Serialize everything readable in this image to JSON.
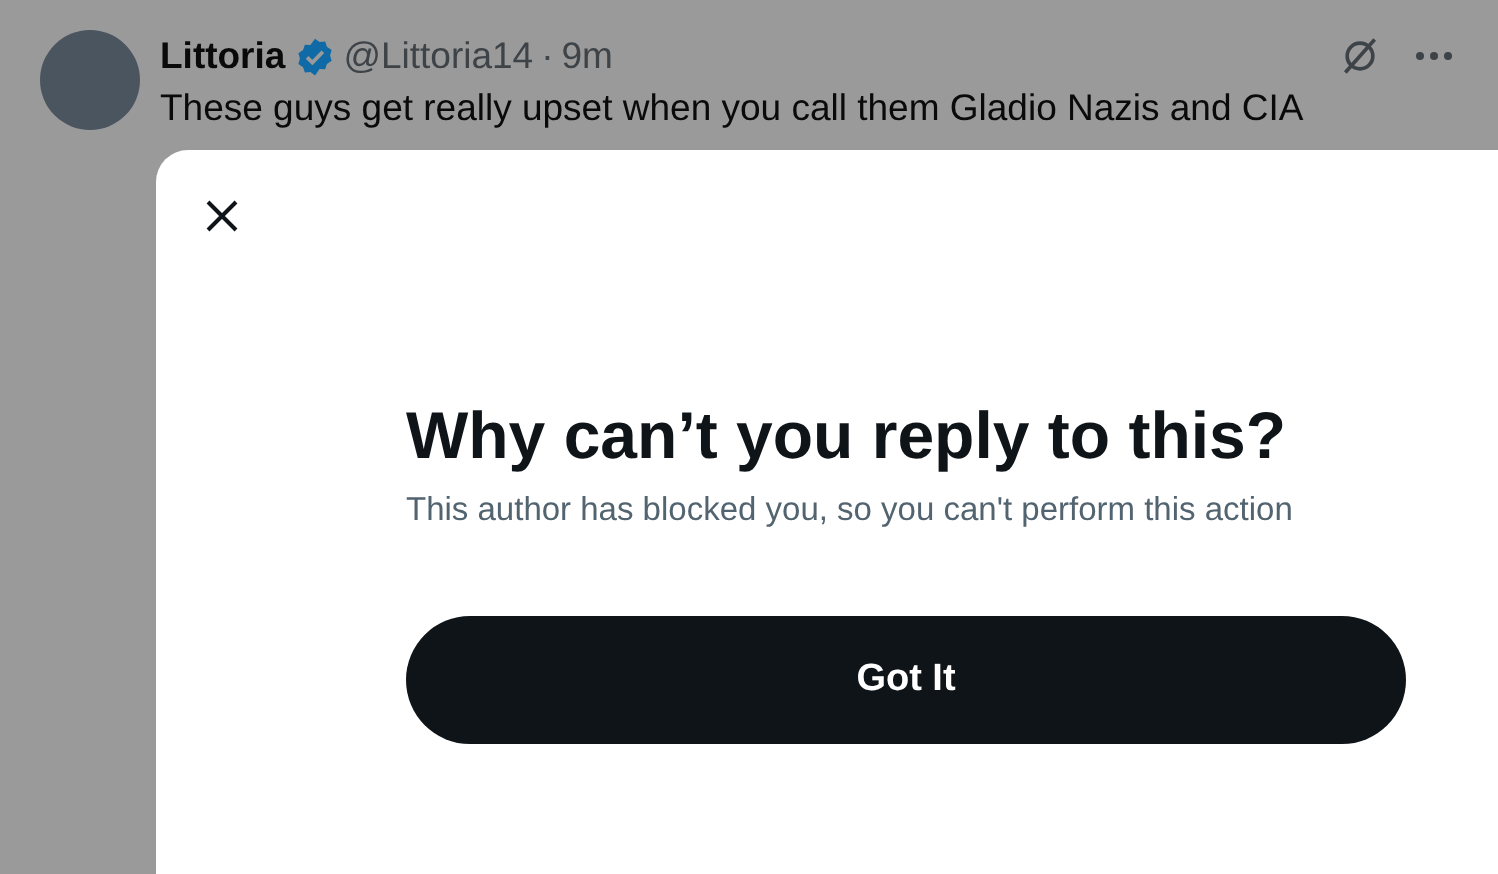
{
  "tweet": {
    "name": "Littoria",
    "verified": true,
    "handle": "@Littoria14",
    "separator": "·",
    "time": "9m",
    "text": "These guys get really upset when you call them Gladio Nazis and CIA"
  },
  "dialog": {
    "title": "Why can’t you reply to this?",
    "message": "This author has blocked you, so you can't perform this action",
    "button": "Got It"
  }
}
